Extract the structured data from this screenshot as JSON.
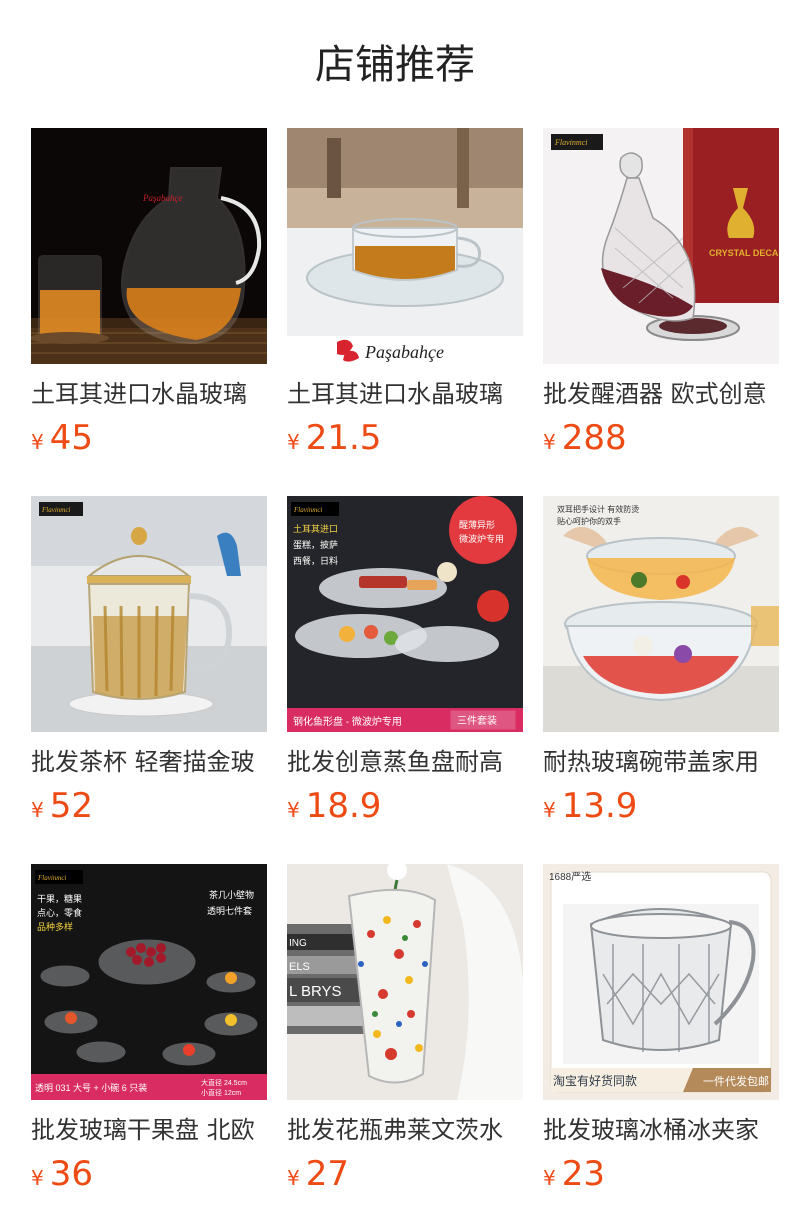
{
  "page": {
    "title": "店铺推荐"
  },
  "colors": {
    "price": "#ee4a14",
    "title": "#333333",
    "heading": "#222222",
    "background": "#ffffff"
  },
  "products": [
    {
      "title": "土耳其进口水晶玻璃",
      "currency": "¥",
      "price": "45",
      "image_icon": "glass-pitcher-and-cup-photo",
      "image_text": [
        "Paşabahçe"
      ]
    },
    {
      "title": "土耳其进口水晶玻璃",
      "currency": "¥",
      "price": "21.5",
      "image_icon": "glass-tea-cup-and-saucer-photo",
      "image_text": [
        "Paşabahçe"
      ]
    },
    {
      "title": "批发醒酒器 欧式创意",
      "currency": "¥",
      "price": "288",
      "image_icon": "crystal-decanter-photo",
      "image_text": [
        "Flavinmci",
        "CRYSTAL DECANTE"
      ]
    },
    {
      "title": "批发茶杯 轻奢描金玻",
      "currency": "¥",
      "price": "52",
      "image_icon": "gold-rim-tea-mug-photo",
      "image_text": [
        "Flavinmci"
      ]
    },
    {
      "title": "批发创意蒸鱼盘耐高",
      "currency": "¥",
      "price": "18.9",
      "image_icon": "fish-shaped-glass-plates-photo",
      "image_text": [
        "Flavinmci",
        "土耳其进口",
        "蛋糕，披萨",
        "西餐，日料",
        "醒薄异形",
        "微波炉专用",
        "钢化鱼形盘 - 微波炉专用",
        "三件套装"
      ]
    },
    {
      "title": "耐热玻璃碗带盖家用",
      "currency": "¥",
      "price": "13.9",
      "image_icon": "glass-bowls-with-lid-photo",
      "image_text": [
        "双耳把手设计 有效防烫",
        "贴心呵护你的双手"
      ]
    },
    {
      "title": "批发玻璃干果盘 北欧",
      "currency": "¥",
      "price": "36",
      "image_icon": "glass-fruit-bowl-set-photo",
      "image_text": [
        "Flavinmci",
        "干果，糖果",
        "点心，零食",
        "品种多样",
        "茶几小壁物",
        "透明七件套",
        "透明 031 大号 + 小碗 6 只装",
        "大直径 24.5cm",
        "小直径 12cm"
      ]
    },
    {
      "title": "批发花瓶弗莱文茨水",
      "currency": "¥",
      "price": "27",
      "image_icon": "painted-glass-vase-photo",
      "image_text": [
        "ING",
        "ELS",
        "L BRYS"
      ]
    },
    {
      "title": "批发玻璃冰桶冰夹家",
      "currency": "¥",
      "price": "23",
      "image_icon": "crystal-ice-bucket-photo",
      "image_text": [
        "1688严选",
        "淘宝有好货同款",
        "一件代发包邮"
      ]
    }
  ]
}
